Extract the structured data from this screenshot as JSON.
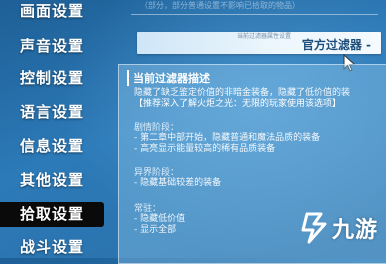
{
  "header": {
    "note": "（部分，部分普通设置不影响已拾取的物品）"
  },
  "sidebar": {
    "items": [
      {
        "label": "画面设置",
        "active": false
      },
      {
        "label": "声音设置",
        "active": false
      },
      {
        "label": "控制设置",
        "active": false
      },
      {
        "label": "语言设置",
        "active": false
      },
      {
        "label": "信息设置",
        "active": false
      },
      {
        "label": "其他设置",
        "active": false
      },
      {
        "label": "拾取设置",
        "active": true
      },
      {
        "label": "战斗设置",
        "active": false
      }
    ]
  },
  "filter": {
    "hint": "当前过滤器属性设置",
    "value": "官方过滤器 -"
  },
  "panel": {
    "title": "当前过滤器描述",
    "lines": [
      "隐藏了缺乏鉴定价值的非暗金装备，隐藏了低价值的装",
      "【推荐深入了解火炬之光：无限的玩家使用该选项】"
    ],
    "sections": [
      {
        "title": "剧情阶段：",
        "lines": [
          "- 第二章中部开始，隐藏普通和魔法品质的装备",
          "- 高亮显示能量较高的稀有品质装备"
        ]
      },
      {
        "title": "异界阶段：",
        "lines": [
          "- 隐藏基础较差的装备"
        ]
      },
      {
        "title": "常驻：",
        "lines": [
          "- 隐藏低价值",
          "- 显示全部"
        ]
      }
    ]
  },
  "watermark": {
    "text": "九游"
  },
  "colors": {
    "background": "#2c7ab8",
    "active_nav": "#0a0a0a",
    "filter_text": "#1d4e7a"
  }
}
